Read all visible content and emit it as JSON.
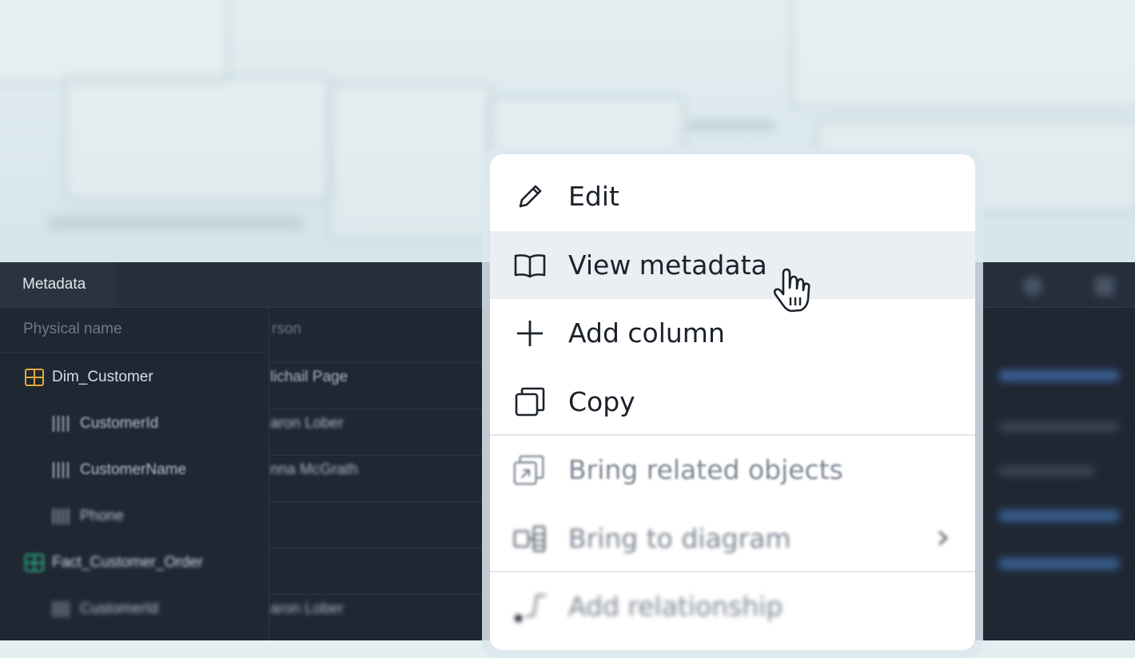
{
  "panel": {
    "tab_label": "Metadata",
    "col_physical_name": "Physical name",
    "col_person_partial": "rson"
  },
  "tree": [
    {
      "label": "Dim_Customer",
      "kind": "table",
      "color": "#e1a83a"
    },
    {
      "label": "CustomerId",
      "kind": "column"
    },
    {
      "label": "CustomerName",
      "kind": "column"
    },
    {
      "label": "Phone",
      "kind": "column"
    },
    {
      "label": "Fact_Customer_Order",
      "kind": "table",
      "color": "#2ebc8e"
    },
    {
      "label": "CustomerId",
      "kind": "column"
    }
  ],
  "persons": [
    "lichail Page",
    "aron Lober",
    "nna McGrath",
    "",
    "",
    "aron Lober"
  ],
  "menu": {
    "items": [
      {
        "label": "Edit",
        "icon": "pencil-icon"
      },
      {
        "label": "View metadata",
        "icon": "book-icon"
      },
      {
        "label": "Add column",
        "icon": "plus-icon"
      },
      {
        "label": "Copy",
        "icon": "copy-icon"
      },
      {
        "label": "Bring related objects",
        "icon": "bring-related-icon"
      },
      {
        "label": "Bring to diagram",
        "icon": "diagram-icon"
      },
      {
        "label": "Add relationship",
        "icon": "relationship-icon"
      }
    ]
  },
  "colors": {
    "panel_bg": "#1f2733",
    "menu_bg": "#ffffff",
    "hover_bg": "#eaeff3",
    "table_orange": "#e1a83a",
    "table_green": "#2ebc8e"
  }
}
